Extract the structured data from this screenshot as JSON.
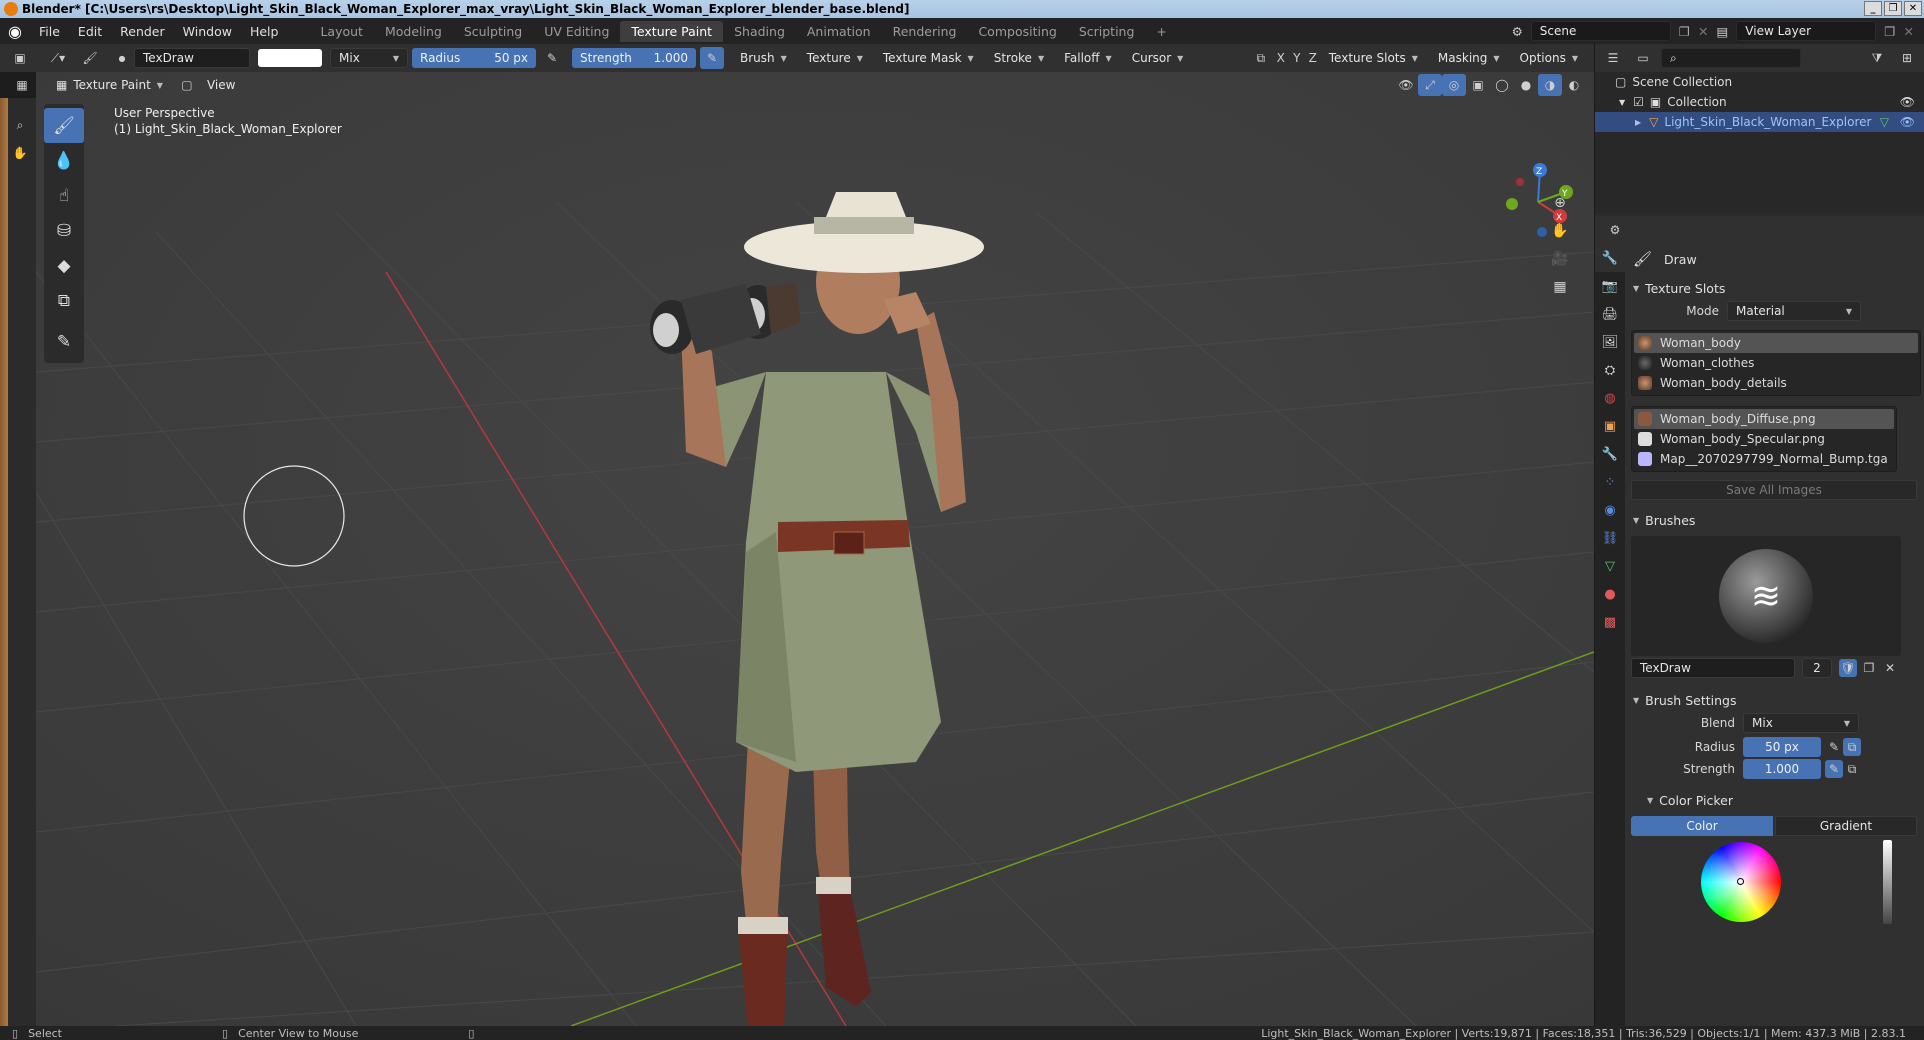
{
  "window": {
    "title": "Blender* [C:\\Users\\rs\\Desktop\\Light_Skin_Black_Woman_Explorer_max_vray\\Light_Skin_Black_Woman_Explorer_blender_base.blend]"
  },
  "menu": {
    "file": "File",
    "edit": "Edit",
    "render": "Render",
    "window": "Window",
    "help": "Help"
  },
  "workspaces": [
    "Layout",
    "Modeling",
    "Sculpting",
    "UV Editing",
    "Texture Paint",
    "Shading",
    "Animation",
    "Rendering",
    "Compositing",
    "Scripting"
  ],
  "active_workspace": "Texture Paint",
  "scene": {
    "scene_name": "Scene",
    "view_layer": "View Layer"
  },
  "tool_header": {
    "brush_name": "TexDraw",
    "blend": "Mix",
    "radius_label": "Radius",
    "radius_value": "50 px",
    "strength_label": "Strength",
    "strength_value": "1.000",
    "brush": "Brush",
    "texture": "Texture",
    "texture_mask": "Texture Mask",
    "stroke": "Stroke",
    "falloff": "Falloff",
    "cursor": "Cursor",
    "axis_x": "X",
    "axis_y": "Y",
    "axis_z": "Z",
    "texture_slots": "Texture Slots",
    "masking": "Masking",
    "options": "Options"
  },
  "viewport_header": {
    "mode": "Texture Paint",
    "view": "View"
  },
  "viewport": {
    "perspective": "User Perspective",
    "object_label": "(1) Light_Skin_Black_Woman_Explorer"
  },
  "outliner": {
    "scene_collection": "Scene Collection",
    "collection": "Collection",
    "object": "Light_Skin_Black_Woman_Explorer"
  },
  "properties": {
    "tool_name": "Draw",
    "texture_slots_title": "Texture Slots",
    "mode_label": "Mode",
    "mode_value": "Material",
    "materials": [
      "Woman_body",
      "Woman_clothes",
      "Woman_body_details"
    ],
    "images": [
      "Woman_body_Diffuse.png",
      "Woman_body_Specular.png",
      "Map__2070297799_Normal_Bump.tga"
    ],
    "save_all_images": "Save All Images",
    "brushes_title": "Brushes",
    "brush_name": "TexDraw",
    "brush_users": "2",
    "brush_settings_title": "Brush Settings",
    "blend_label": "Blend",
    "blend_value": "Mix",
    "radius_label": "Radius",
    "radius_value": "50 px",
    "strength_label": "Strength",
    "strength_value": "1.000",
    "color_picker_title": "Color Picker",
    "color_tab": "Color",
    "gradient_tab": "Gradient"
  },
  "statusbar": {
    "select": "Select",
    "center_view": "Center View to Mouse",
    "stats": "Light_Skin_Black_Woman_Explorer | Verts:19,871 | Faces:18,351 | Tris:36,529 | Objects:1/1 | Mem: 437.3 MiB | 2.83.1"
  },
  "colors": {
    "accent": "#4772b3",
    "viewport_bg": "#3d3d3d",
    "panel_bg": "#303030",
    "x_axis": "#c0392b",
    "y_axis": "#6c9e1e"
  }
}
